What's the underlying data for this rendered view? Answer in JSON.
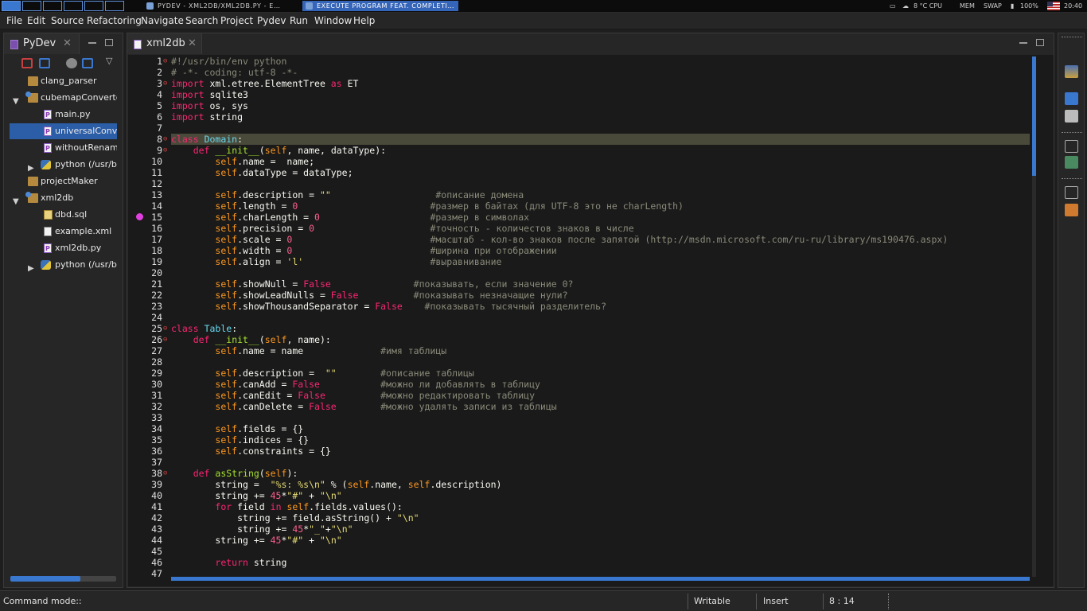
{
  "system_bar": {
    "tasks": [
      {
        "label": "PYDEV - XML2DB/XML2DB.PY - E…",
        "active": false
      },
      {
        "label": "EXECUTE PROGRAM FEAT. COMPLETI…",
        "active": true
      }
    ],
    "temperature": "8 °C CPU",
    "mem_label": "MEM",
    "swap_label": "SWAP",
    "battery": "100%",
    "clock": "20:40"
  },
  "menu": [
    "File",
    "Edit",
    "Source",
    "Refactoring",
    "Navigate",
    "Search",
    "Project",
    "Pydev",
    "Run",
    "Window",
    "Help"
  ],
  "left_panel": {
    "title": "PyDev",
    "tree": [
      {
        "label": "clang_parser",
        "icon": "folder-icon",
        "indent": 1,
        "twisty": ""
      },
      {
        "label": "cubemapConverter",
        "icon": "project-icon",
        "indent": 1,
        "twisty": "▼"
      },
      {
        "label": "main.py",
        "icon": "python-file-icon",
        "indent": 2,
        "twisty": ""
      },
      {
        "label": "universalConver",
        "icon": "python-file-icon",
        "indent": 2,
        "twisty": "",
        "selected": true
      },
      {
        "label": "withoutRename",
        "icon": "python-file-icon",
        "indent": 2,
        "twisty": ""
      },
      {
        "label": "python (/usr/bir",
        "icon": "python-interpreter-icon",
        "indent": 2,
        "twisty": "▶"
      },
      {
        "label": "projectMaker",
        "icon": "folder-icon",
        "indent": 1,
        "twisty": ""
      },
      {
        "label": "xml2db",
        "icon": "project-icon",
        "indent": 1,
        "twisty": "▼"
      },
      {
        "label": "dbd.sql",
        "icon": "sql-file-icon",
        "indent": 2,
        "twisty": ""
      },
      {
        "label": "example.xml",
        "icon": "xml-file-icon",
        "indent": 2,
        "twisty": ""
      },
      {
        "label": "xml2db.py",
        "icon": "python-file-icon",
        "indent": 2,
        "twisty": ""
      },
      {
        "label": "python (/usr/bir",
        "icon": "python-interpreter-icon",
        "indent": 2,
        "twisty": "▶"
      }
    ]
  },
  "editor": {
    "tab_title": "xml2db",
    "lines": [
      {
        "n": "1",
        "fold": "⊖",
        "t": [
          [
            "c",
            "#!/usr/bin/env python"
          ]
        ]
      },
      {
        "n": "2",
        "fold": "",
        "t": [
          [
            "c",
            "# -*- coding: utf-8 -*-"
          ]
        ]
      },
      {
        "n": "3",
        "fold": "⊖",
        "t": [
          [
            "k",
            "import"
          ],
          [
            "",
            " xml.etree.ElementTree "
          ],
          [
            "k",
            "as"
          ],
          [
            "",
            " ET"
          ]
        ]
      },
      {
        "n": "4",
        "fold": "",
        "t": [
          [
            "k",
            "import"
          ],
          [
            "",
            " sqlite3"
          ]
        ]
      },
      {
        "n": "5",
        "fold": "",
        "t": [
          [
            "k",
            "import"
          ],
          [
            "",
            " os, sys"
          ]
        ]
      },
      {
        "n": "6",
        "fold": "",
        "t": [
          [
            "k",
            "import"
          ],
          [
            "",
            " string"
          ]
        ]
      },
      {
        "n": "7",
        "fold": "",
        "t": []
      },
      {
        "n": "8",
        "fold": "⊖",
        "t": [
          [
            "k",
            "class"
          ],
          [
            "",
            " "
          ],
          [
            "cls",
            "Domain"
          ],
          [
            "",
            ":"
          ]
        ]
      },
      {
        "n": "9",
        "fold": "⊖",
        "t": [
          [
            "",
            "    "
          ],
          [
            "k",
            "def"
          ],
          [
            "",
            " "
          ],
          [
            "f",
            "__init__"
          ],
          [
            "",
            "("
          ],
          [
            "ar",
            "self"
          ],
          [
            "",
            ", name, dataType):"
          ]
        ]
      },
      {
        "n": "10",
        "fold": "",
        "t": [
          [
            "",
            "        "
          ],
          [
            "ar",
            "self"
          ],
          [
            "",
            ".name =  name;"
          ]
        ]
      },
      {
        "n": "11",
        "fold": "",
        "t": [
          [
            "",
            "        "
          ],
          [
            "ar",
            "self"
          ],
          [
            "",
            ".dataType = dataType;"
          ]
        ]
      },
      {
        "n": "12",
        "fold": "",
        "t": []
      },
      {
        "n": "13",
        "fold": "",
        "t": [
          [
            "",
            "        "
          ],
          [
            "ar",
            "self"
          ],
          [
            "",
            ".description = "
          ],
          [
            "s",
            "\"\""
          ],
          [
            "",
            "                   "
          ],
          [
            "c",
            "#описание домена"
          ]
        ]
      },
      {
        "n": "14",
        "fold": "",
        "t": [
          [
            "",
            "        "
          ],
          [
            "ar",
            "self"
          ],
          [
            "",
            ".length = "
          ],
          [
            "sf",
            "0"
          ],
          [
            "",
            "                        "
          ],
          [
            "c",
            "#размер в байтах (для UTF-8 это не charLength)"
          ]
        ]
      },
      {
        "n": "15",
        "fold": "",
        "t": [
          [
            "",
            "        "
          ],
          [
            "ar",
            "self"
          ],
          [
            "",
            ".charLength = "
          ],
          [
            "sf",
            "0"
          ],
          [
            "",
            "                    "
          ],
          [
            "c",
            "#размер в символах"
          ]
        ]
      },
      {
        "n": "16",
        "fold": "",
        "t": [
          [
            "",
            "        "
          ],
          [
            "ar",
            "self"
          ],
          [
            "",
            ".precision = "
          ],
          [
            "sf",
            "0"
          ],
          [
            "",
            "                     "
          ],
          [
            "c",
            "#точность - количестов знаков в числе"
          ]
        ]
      },
      {
        "n": "17",
        "fold": "",
        "t": [
          [
            "",
            "        "
          ],
          [
            "ar",
            "self"
          ],
          [
            "",
            ".scale = "
          ],
          [
            "sf",
            "0"
          ],
          [
            "",
            "                         "
          ],
          [
            "c",
            "#масштаб - кол-во знаков после запятой (http://msdn.microsoft.com/ru-ru/library/ms190476.aspx)"
          ]
        ]
      },
      {
        "n": "18",
        "fold": "",
        "t": [
          [
            "",
            "        "
          ],
          [
            "ar",
            "self"
          ],
          [
            "",
            ".width = "
          ],
          [
            "sf",
            "0"
          ],
          [
            "",
            "                         "
          ],
          [
            "c",
            "#ширина при отображении"
          ]
        ]
      },
      {
        "n": "19",
        "fold": "",
        "t": [
          [
            "",
            "        "
          ],
          [
            "ar",
            "self"
          ],
          [
            "",
            ".align = "
          ],
          [
            "s",
            "'l'"
          ],
          [
            "",
            "                       "
          ],
          [
            "c",
            "#выравнивание"
          ]
        ]
      },
      {
        "n": "20",
        "fold": "",
        "t": []
      },
      {
        "n": "21",
        "fold": "",
        "t": [
          [
            "",
            "        "
          ],
          [
            "ar",
            "self"
          ],
          [
            "",
            ".showNull = "
          ],
          [
            "bool",
            "False"
          ],
          [
            "",
            "               "
          ],
          [
            "c",
            "#показывать, если значение 0?"
          ]
        ]
      },
      {
        "n": "22",
        "fold": "",
        "t": [
          [
            "",
            "        "
          ],
          [
            "ar",
            "self"
          ],
          [
            "",
            ".showLeadNulls = "
          ],
          [
            "bool",
            "False"
          ],
          [
            "",
            "          "
          ],
          [
            "c",
            "#показывать незначащие нули?"
          ]
        ]
      },
      {
        "n": "23",
        "fold": "",
        "t": [
          [
            "",
            "        "
          ],
          [
            "ar",
            "self"
          ],
          [
            "",
            ".showThousandSeparator = "
          ],
          [
            "bool",
            "False"
          ],
          [
            "",
            "    "
          ],
          [
            "c",
            "#показывать тысячный разделитель?"
          ]
        ]
      },
      {
        "n": "24",
        "fold": "",
        "t": []
      },
      {
        "n": "25",
        "fold": "⊖",
        "t": [
          [
            "k",
            "class"
          ],
          [
            "",
            " "
          ],
          [
            "cls",
            "Table"
          ],
          [
            "",
            ":"
          ]
        ]
      },
      {
        "n": "26",
        "fold": "⊖",
        "t": [
          [
            "",
            "    "
          ],
          [
            "k",
            "def"
          ],
          [
            "",
            " "
          ],
          [
            "f",
            "__init__"
          ],
          [
            "",
            "("
          ],
          [
            "ar",
            "self"
          ],
          [
            "",
            ", name):"
          ]
        ]
      },
      {
        "n": "27",
        "fold": "",
        "t": [
          [
            "",
            "        "
          ],
          [
            "ar",
            "self"
          ],
          [
            "",
            ".name = name              "
          ],
          [
            "c",
            "#имя таблицы"
          ]
        ]
      },
      {
        "n": "28",
        "fold": "",
        "t": []
      },
      {
        "n": "29",
        "fold": "",
        "t": [
          [
            "",
            "        "
          ],
          [
            "ar",
            "self"
          ],
          [
            "",
            ".description =  "
          ],
          [
            "s",
            "\"\""
          ],
          [
            "",
            "        "
          ],
          [
            "c",
            "#описание таблицы"
          ]
        ]
      },
      {
        "n": "30",
        "fold": "",
        "t": [
          [
            "",
            "        "
          ],
          [
            "ar",
            "self"
          ],
          [
            "",
            ".canAdd = "
          ],
          [
            "bool",
            "False"
          ],
          [
            "",
            "           "
          ],
          [
            "c",
            "#можно ли добавлять в таблицу"
          ]
        ]
      },
      {
        "n": "31",
        "fold": "",
        "t": [
          [
            "",
            "        "
          ],
          [
            "ar",
            "self"
          ],
          [
            "",
            ".canEdit = "
          ],
          [
            "bool",
            "False"
          ],
          [
            "",
            "          "
          ],
          [
            "c",
            "#можно редактировать таблицу"
          ]
        ]
      },
      {
        "n": "32",
        "fold": "",
        "t": [
          [
            "",
            "        "
          ],
          [
            "ar",
            "self"
          ],
          [
            "",
            ".canDelete = "
          ],
          [
            "bool",
            "False"
          ],
          [
            "",
            "        "
          ],
          [
            "c",
            "#можно удалять записи из таблицы"
          ]
        ]
      },
      {
        "n": "33",
        "fold": "",
        "t": []
      },
      {
        "n": "34",
        "fold": "",
        "t": [
          [
            "",
            "        "
          ],
          [
            "ar",
            "self"
          ],
          [
            "",
            ".fields = {}"
          ]
        ]
      },
      {
        "n": "35",
        "fold": "",
        "t": [
          [
            "",
            "        "
          ],
          [
            "ar",
            "self"
          ],
          [
            "",
            ".indices = {}"
          ]
        ]
      },
      {
        "n": "36",
        "fold": "",
        "t": [
          [
            "",
            "        "
          ],
          [
            "ar",
            "self"
          ],
          [
            "",
            ".constraints = {}"
          ]
        ]
      },
      {
        "n": "37",
        "fold": "",
        "t": []
      },
      {
        "n": "38",
        "fold": "⊖",
        "t": [
          [
            "",
            "    "
          ],
          [
            "k",
            "def"
          ],
          [
            "",
            " "
          ],
          [
            "f",
            "asString"
          ],
          [
            "",
            "("
          ],
          [
            "ar",
            "self"
          ],
          [
            "",
            "):"
          ]
        ]
      },
      {
        "n": "39",
        "fold": "",
        "t": [
          [
            "",
            "        string =  "
          ],
          [
            "s",
            "\"%s: %s\\n\""
          ],
          [
            "",
            " % ("
          ],
          [
            "ar",
            "self"
          ],
          [
            "",
            ".name, "
          ],
          [
            "ar",
            "self"
          ],
          [
            "",
            ".description)"
          ]
        ]
      },
      {
        "n": "40",
        "fold": "",
        "t": [
          [
            "",
            "        string += "
          ],
          [
            "sf",
            "45"
          ],
          [
            "",
            "*"
          ],
          [
            "s",
            "\"#\""
          ],
          [
            "",
            " + "
          ],
          [
            "s",
            "\"\\n\""
          ]
        ]
      },
      {
        "n": "41",
        "fold": "",
        "t": [
          [
            "",
            "        "
          ],
          [
            "k",
            "for"
          ],
          [
            "",
            " field "
          ],
          [
            "k",
            "in"
          ],
          [
            "",
            " "
          ],
          [
            "ar",
            "self"
          ],
          [
            "",
            ".fields.values():"
          ]
        ]
      },
      {
        "n": "42",
        "fold": "",
        "t": [
          [
            "",
            "            string += field.asString() + "
          ],
          [
            "s",
            "\"\\n\""
          ]
        ]
      },
      {
        "n": "43",
        "fold": "",
        "t": [
          [
            "",
            "            string += "
          ],
          [
            "sf",
            "45"
          ],
          [
            "",
            "*"
          ],
          [
            "s",
            "\"_\""
          ],
          [
            "",
            "+"
          ],
          [
            "s",
            "\"\\n\""
          ]
        ]
      },
      {
        "n": "44",
        "fold": "",
        "t": [
          [
            "",
            "        string += "
          ],
          [
            "sf",
            "45"
          ],
          [
            "",
            "*"
          ],
          [
            "s",
            "\"#\""
          ],
          [
            "",
            " + "
          ],
          [
            "s",
            "\"\\n\""
          ]
        ]
      },
      {
        "n": "45",
        "fold": "",
        "t": []
      },
      {
        "n": "46",
        "fold": "",
        "t": [
          [
            "",
            "        "
          ],
          [
            "k",
            "return"
          ],
          [
            "",
            " string"
          ]
        ]
      },
      {
        "n": "47",
        "fold": "",
        "t": []
      }
    ],
    "current_line": "8"
  },
  "status": {
    "mode": "Command mode::",
    "writable": "Writable",
    "insert": "Insert",
    "position": "8 : 14"
  },
  "colors": {
    "keyword": "#f92672",
    "comment": "#8a8a7a",
    "string": "#e6db74",
    "accent": "#3a78d0"
  }
}
